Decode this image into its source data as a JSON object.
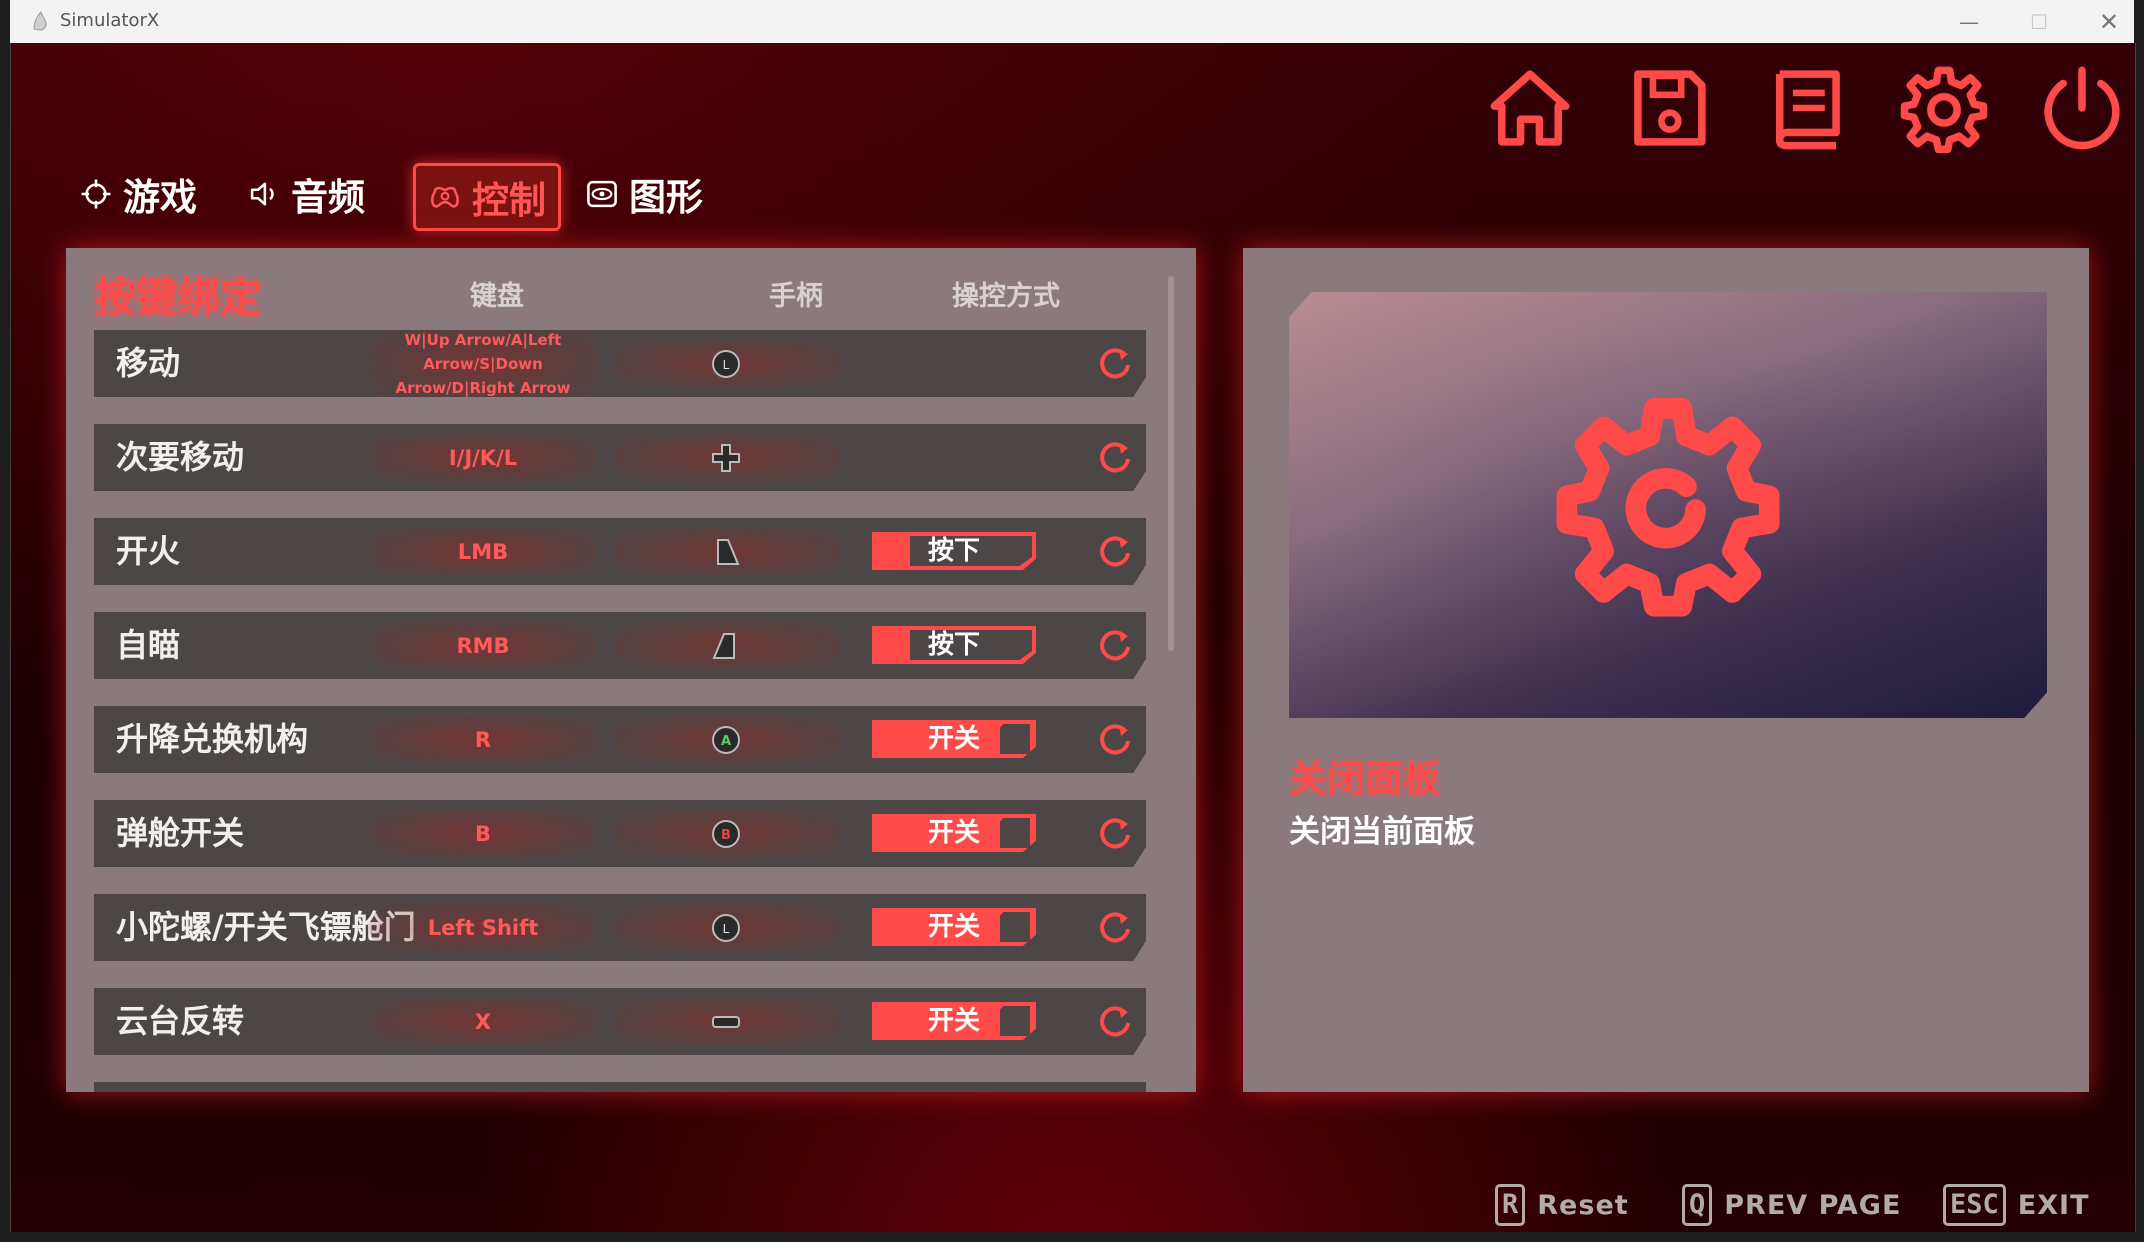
{
  "window": {
    "title": "SimulatorX",
    "min_glyph": "—",
    "max_glyph": "☐",
    "close_glyph": "✕"
  },
  "top_icons": [
    "home-icon",
    "save-icon",
    "book-icon",
    "settings-icon",
    "power-icon"
  ],
  "colors": {
    "accent": "#ff4a4a",
    "panel": "#8a7a7d",
    "row": "#4d4646"
  },
  "tabs": [
    {
      "label": "游戏",
      "icon": "crosshair-icon"
    },
    {
      "label": "音频",
      "icon": "speaker-icon"
    },
    {
      "label": "控制",
      "icon": "gamepad-icon",
      "active": true
    },
    {
      "label": "图形",
      "icon": "eye-icon"
    }
  ],
  "bindings": {
    "title": "按键绑定",
    "columns": {
      "keyboard": "键盘",
      "gamepad": "手柄",
      "mode": "操控方式"
    },
    "rows": [
      {
        "label": "移动",
        "key": "W|Up Arrow/A|Left Arrow/S|Down Arrow/D|Right Arrow",
        "pad_icon": "left-stick-icon",
        "mode": ""
      },
      {
        "label": "次要移动",
        "key": "I/J/K/L",
        "pad_icon": "dpad-icon",
        "mode": ""
      },
      {
        "label": "开火",
        "key": "LMB",
        "pad_icon": "right-trigger-icon",
        "mode": "按下"
      },
      {
        "label": "自瞄",
        "key": "RMB",
        "pad_icon": "left-trigger-icon",
        "mode": "按下"
      },
      {
        "label": "升降兑换机构",
        "key": "R",
        "pad_icon": "a-button-icon",
        "mode": "开关"
      },
      {
        "label": "弹舱开关",
        "key": "B",
        "pad_icon": "b-button-icon",
        "mode": "开关"
      },
      {
        "label": "小陀螺/开关飞镖舱门",
        "key": "Left Shift",
        "pad_icon": "left-stick-press-icon",
        "mode": "开关"
      },
      {
        "label": "云台反转",
        "key": "X",
        "pad_icon": "view-button-icon",
        "mode": "开关"
      }
    ]
  },
  "detail": {
    "title": "关闭面板",
    "description": "关闭当前面板",
    "preview_icon": "settings-icon"
  },
  "hints": [
    {
      "key": "R",
      "label": "Reset"
    },
    {
      "key": "Q",
      "label": "PREV PAGE"
    },
    {
      "key": "ESC",
      "label": "EXIT"
    }
  ]
}
